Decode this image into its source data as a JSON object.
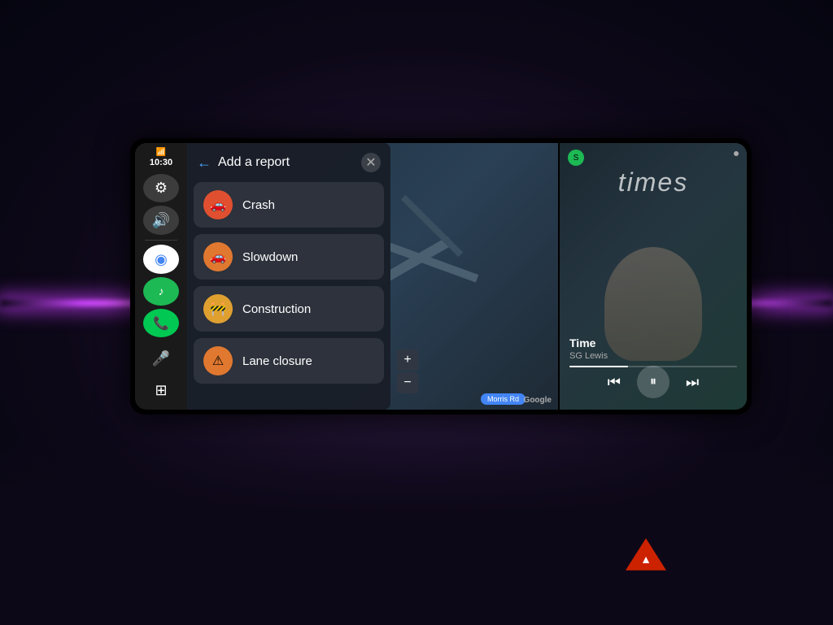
{
  "screen": {
    "time": "10:30",
    "signal": "📶"
  },
  "sidebar": {
    "settings_icon": "⚙",
    "volume_icon": "🔊",
    "maps_icon": "◉",
    "spotify_icon": "♪",
    "phone_icon": "📞",
    "mic_icon": "🎤",
    "grid_icon": "⊞",
    "plus_icon": "+",
    "minus_icon": "−"
  },
  "report_panel": {
    "title": "Add a report",
    "back_label": "←",
    "close_label": "✕",
    "items": [
      {
        "id": "crash",
        "label": "Crash",
        "icon": "🚗",
        "icon_class": "icon-crash"
      },
      {
        "id": "slowdown",
        "label": "Slowdown",
        "icon": "🚗",
        "icon_class": "icon-slowdown"
      },
      {
        "id": "construction",
        "label": "Construction",
        "icon": "🚧",
        "icon_class": "icon-construction"
      },
      {
        "id": "lane-closure",
        "label": "Lane closure",
        "icon": "⚠",
        "icon_class": "icon-lane"
      }
    ]
  },
  "map": {
    "google_label": "Google",
    "location_badge": "Morris Rd"
  },
  "music": {
    "big_title": "times",
    "track_name": "Time",
    "artist": "SG Lewis",
    "progress_percent": 35,
    "prev_icon": "⏮",
    "pause_icon": "⏸",
    "next_icon": "⏭"
  },
  "colors": {
    "accent_purple": "#cc44ff",
    "map_bg": "#2a3a4a",
    "sidebar_bg": "#1a1a1a",
    "panel_bg": "#191e28",
    "music_bg": "#1a2830"
  }
}
